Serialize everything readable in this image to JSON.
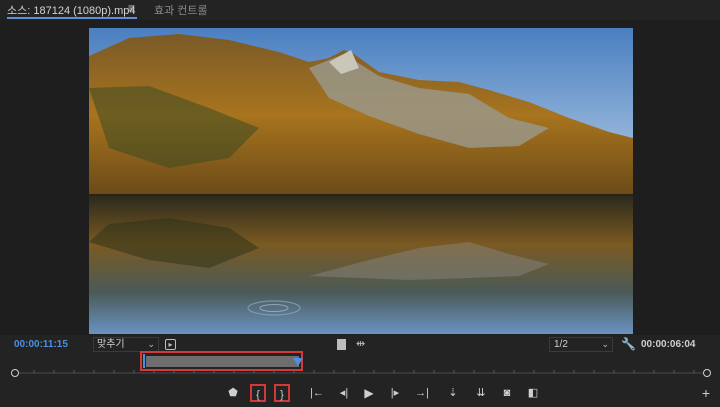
{
  "tabs": {
    "source_label": "소스: 187124 (1080p).mp4",
    "menu_glyph": "≡",
    "effects_label": "효과 컨트롤"
  },
  "monitor": {
    "current_timecode": "00:00:11:15",
    "fit_select_value": "맞추기",
    "resolution_value": "1/2",
    "duration_timecode": "00:00:06:04"
  },
  "icons": {
    "chevron": "⌄",
    "wrench": "🔧",
    "drag_audio": "⇹",
    "small_box": "▸",
    "marker": "⬟",
    "mark_in": "{",
    "mark_out": "}",
    "goto_in": "|←",
    "step_back": "◂|",
    "play": "▶",
    "step_fwd": "|▸",
    "goto_out": "→|",
    "insert": "⇣",
    "overwrite": "⇊",
    "export_frame": "◙",
    "compare": "◧",
    "add": "+"
  },
  "colors": {
    "accent_blue": "#4d8fe0",
    "highlight_red": "#d23a3a"
  }
}
